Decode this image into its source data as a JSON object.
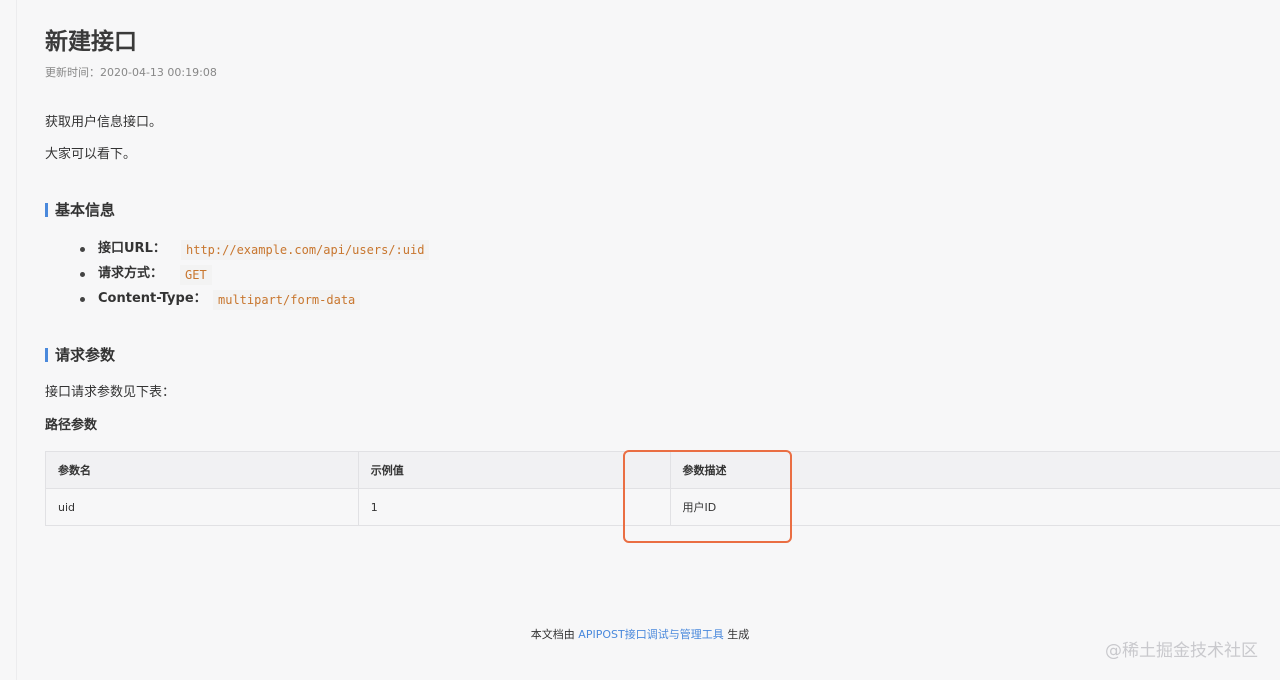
{
  "doc": {
    "title": "新建接口",
    "updated_label": "更新时间：",
    "updated_value": "2020-04-13 00:19:08",
    "desc_lines": [
      "获取用户信息接口。",
      "大家可以看下。"
    ]
  },
  "basic_info": {
    "heading": "基本信息",
    "items": [
      {
        "key": "接口URL：",
        "value": "http://example.com/api/users/:uid"
      },
      {
        "key": "请求方式：",
        "value": "GET"
      },
      {
        "key": "Content-Type：",
        "value": "multipart/form-data"
      }
    ]
  },
  "request_params": {
    "heading": "请求参数",
    "intro": "接口请求参数见下表：",
    "path_heading": "路径参数",
    "columns": [
      "参数名",
      "示例值",
      "参数描述"
    ],
    "rows": [
      [
        "uid",
        "1",
        "用户ID"
      ]
    ]
  },
  "footer": {
    "prefix": "本文档由 ",
    "link": "APIPOST接口调试与管理工具",
    "suffix": " 生成"
  },
  "watermark": "@稀土掘金技术社区",
  "colors": {
    "accent_bar": "#4a89dc",
    "code_text": "#c8762e",
    "highlight_box": "#ea6e43",
    "link": "#4a89dc"
  }
}
